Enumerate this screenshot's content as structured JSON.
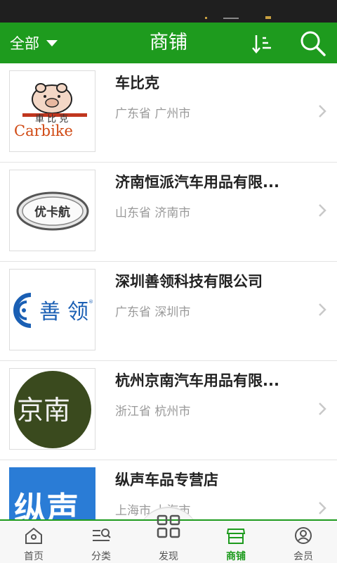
{
  "colors": {
    "brand": "#1e9b1e",
    "status_bar": "#1f1f1f",
    "text_primary": "#222222",
    "text_secondary": "#9a9a9a"
  },
  "header": {
    "filter_label": "全部",
    "title": "商铺",
    "sort_icon": "sort-icon",
    "search_icon": "search-icon"
  },
  "shops": [
    {
      "name": "车比克",
      "location": "广东省 广州市",
      "logo": "carbike-logo",
      "logo_text": "車比克 Carbike"
    },
    {
      "name": "济南恒派汽车用品有限...",
      "location": "山东省 济南市",
      "logo": "youkahang-logo",
      "logo_text": "优卡航"
    },
    {
      "name": "深圳善领科技有限公司",
      "location": "广东省 深圳市",
      "logo": "shanling-logo",
      "logo_text": "善 领"
    },
    {
      "name": "杭州京南汽车用品有限...",
      "location": "浙江省 杭州市",
      "logo": "jingnan-logo",
      "logo_text": "京南"
    },
    {
      "name": "纵声车品专营店",
      "location": "上海市 上海市",
      "logo": "zongsheng-logo",
      "logo_text": "纵声"
    }
  ],
  "tabs": [
    {
      "label": "首页",
      "icon": "home-icon"
    },
    {
      "label": "分类",
      "icon": "category-icon"
    },
    {
      "label": "发现",
      "icon": "discover-icon"
    },
    {
      "label": "商铺",
      "icon": "shop-icon"
    },
    {
      "label": "会员",
      "icon": "member-icon"
    }
  ]
}
